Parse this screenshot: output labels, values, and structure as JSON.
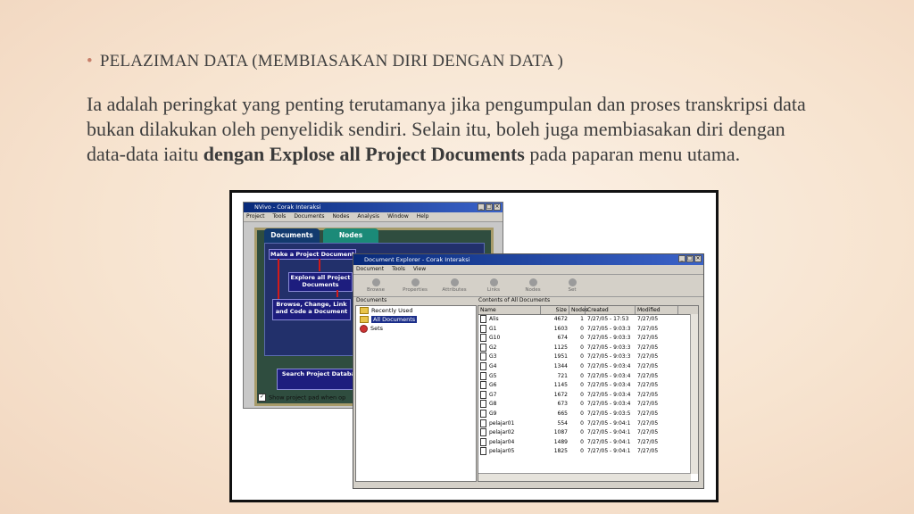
{
  "slide": {
    "bullet": "PELAZIMAN DATA (MEMBIASAKAN DIRI DENGAN DATA )",
    "para_1": "Ia adalah peringkat yang penting terutamanya jika pengumpulan dan proses transkripsi data bukan dilakukan oleh penyelidik sendiri. Selain itu, boleh juga membiasakan diri dengan data-data iaitu ",
    "para_bold": "dengan Explose all Project Documents",
    "para_2": " pada paparan menu utama."
  },
  "nvivo": {
    "title": "NVivo - Corak Interaksi",
    "menu": [
      "Project",
      "Tools",
      "Documents",
      "Nodes",
      "Analysis",
      "Window",
      "Help"
    ],
    "tabs": {
      "documents": "Documents",
      "nodes": "Nodes"
    },
    "buttons": {
      "make": "Make a Project Document",
      "explore": "Explore all Project Documents",
      "browse": "Browse, Change, Link and Code a Document",
      "search": "Search Project Database"
    },
    "show_pad": "Show project pad when op"
  },
  "explorer": {
    "title": "Document Explorer - Corak Interaksi",
    "menu": [
      "Document",
      "Tools",
      "View"
    ],
    "tools": [
      "Browse",
      "Properties",
      "Attributes",
      "Links",
      "Nodes",
      "Set"
    ],
    "left_header": "Documents",
    "right_header": "Contents of All Documents",
    "tree": [
      "Recently Used",
      "All Documents",
      "Sets"
    ],
    "columns": [
      "Name",
      "Size",
      "Nodes",
      "Created",
      "Modified"
    ],
    "rows": [
      [
        "Alis",
        "4672",
        "1",
        "7/27/05 - 17:53",
        "7/27/05"
      ],
      [
        "G1",
        "1603",
        "0",
        "7/27/05 - 9:03:3",
        "7/27/05"
      ],
      [
        "G10",
        "674",
        "0",
        "7/27/05 - 9:03:3",
        "7/27/05"
      ],
      [
        "G2",
        "1125",
        "0",
        "7/27/05 - 9:03:3",
        "7/27/05"
      ],
      [
        "G3",
        "1951",
        "0",
        "7/27/05 - 9:03:3",
        "7/27/05"
      ],
      [
        "G4",
        "1344",
        "0",
        "7/27/05 - 9:03:4",
        "7/27/05"
      ],
      [
        "G5",
        "721",
        "0",
        "7/27/05 - 9:03:4",
        "7/27/05"
      ],
      [
        "G6",
        "1145",
        "0",
        "7/27/05 - 9:03:4",
        "7/27/05"
      ],
      [
        "G7",
        "1672",
        "0",
        "7/27/05 - 9:03:4",
        "7/27/05"
      ],
      [
        "G8",
        "673",
        "0",
        "7/27/05 - 9:03:4",
        "7/27/05"
      ],
      [
        "G9",
        "665",
        "0",
        "7/27/05 - 9:03:5",
        "7/27/05"
      ],
      [
        "pelajar01",
        "554",
        "0",
        "7/27/05 - 9:04:1",
        "7/27/05"
      ],
      [
        "pelajar02",
        "1087",
        "0",
        "7/27/05 - 9:04:1",
        "7/27/05"
      ],
      [
        "pelajar04",
        "1489",
        "0",
        "7/27/05 - 9:04:1",
        "7/27/05"
      ],
      [
        "pelajar05",
        "1825",
        "0",
        "7/27/05 - 9:04:1",
        "7/27/05"
      ]
    ]
  }
}
